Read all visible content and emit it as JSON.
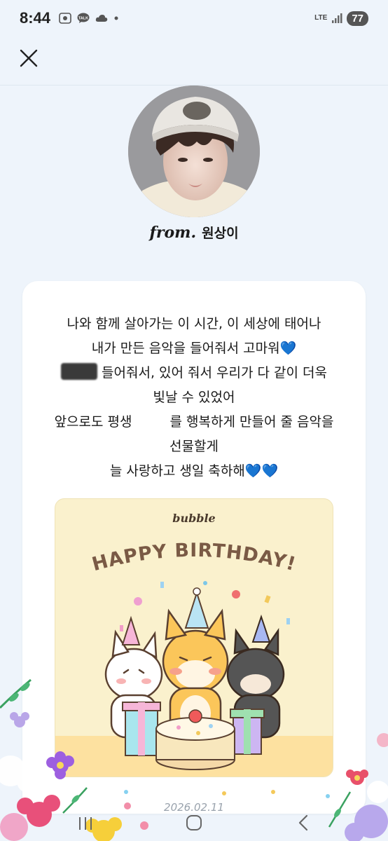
{
  "status_bar": {
    "time": "8:44",
    "network": "LTE",
    "battery": "77"
  },
  "header": {
    "close_icon": "close-icon"
  },
  "profile": {
    "from_label": "from.",
    "name": "원상이"
  },
  "message": {
    "lines": [
      "나와 함께 살아가는 이 시간, 이 세상에 태어나",
      "내가 만든 음악을 들어줘서 고마워💙",
      "들어줘서, 있어 줘서 우리가 다 같이 더욱",
      "빛날 수 있었어",
      "앞으로도 평생",
      "를 행복하게 만들어 줄 음악을",
      "선물할게",
      "늘 사랑하고 생일 축하해💙💙"
    ]
  },
  "birthday_card": {
    "brand": "bubble",
    "title": "HAPPY BIRTHDAY!"
  },
  "footer": {
    "date": "2026.02.11"
  },
  "colors": {
    "background": "#eef4fb",
    "card": "#ffffff",
    "birthday_bg": "#faf1cd",
    "birthday_title": "#7a5a45"
  }
}
